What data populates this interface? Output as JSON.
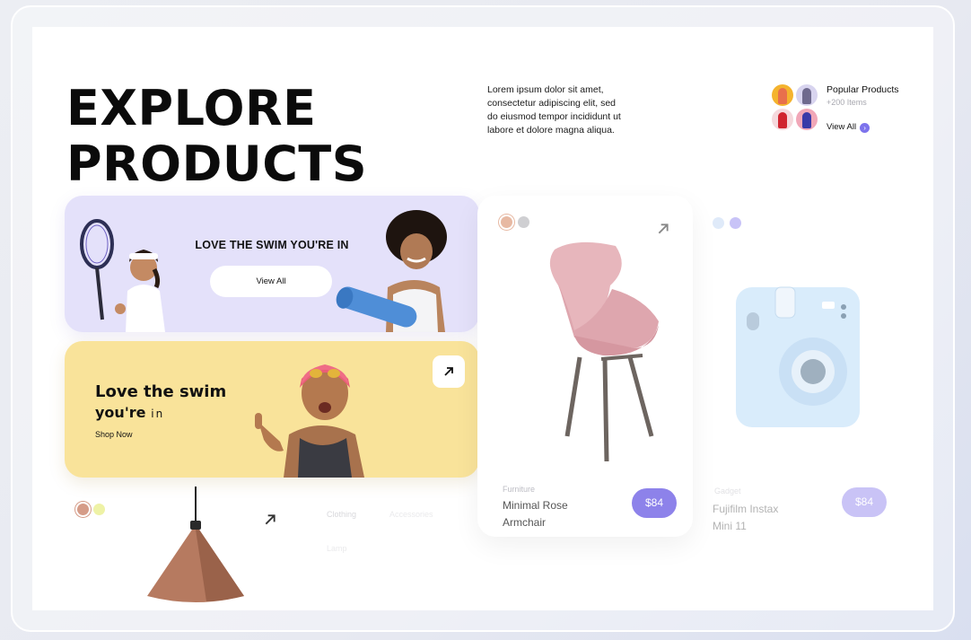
{
  "headline": {
    "line1": "EXPLORE",
    "line2": "PRODUCTS"
  },
  "intro": {
    "text": "Lorem ipsum dolor sit amet, consectetur adipiscing elit, sed do eiusmod tempor incididunt ut labore et dolore magna aliqua."
  },
  "popular": {
    "title": "Popular Products",
    "count": "+200 Items",
    "view_all": "View All",
    "view_all_icon": "arrow-right-icon"
  },
  "banner_lavender": {
    "heading": "LOVE THE SWIM YOU'RE IN",
    "button": "View All"
  },
  "banner_yellow": {
    "line1": "Love the swim",
    "line2_bold": "you're",
    "line2_light": " in",
    "link": "Shop Now",
    "arrow_icon": "arrow-up-right-icon"
  },
  "product_chair": {
    "category": "Furniture",
    "name_line1": "Minimal Rose",
    "name_line2": "Armchair",
    "price": "$84",
    "swatches": [
      "#e7b9a3",
      "#cfcfd2"
    ]
  },
  "product_camera": {
    "category": "Gadget",
    "name_line1": "Fujifilm Instax",
    "name_line2": "Mini 11",
    "price": "$84",
    "swatches": [
      "#c9dcf5",
      "#c8c3f7"
    ]
  },
  "lamp_card": {
    "swatches": [
      "#d59c88",
      "#eef2a6"
    ]
  },
  "filters": {
    "a": "Clothing",
    "b": "Accessories",
    "c": "Lamp"
  },
  "colors": {
    "accent": "#8d82ea",
    "lavender": "#e4e1fa",
    "yellow": "#f9e39a"
  }
}
